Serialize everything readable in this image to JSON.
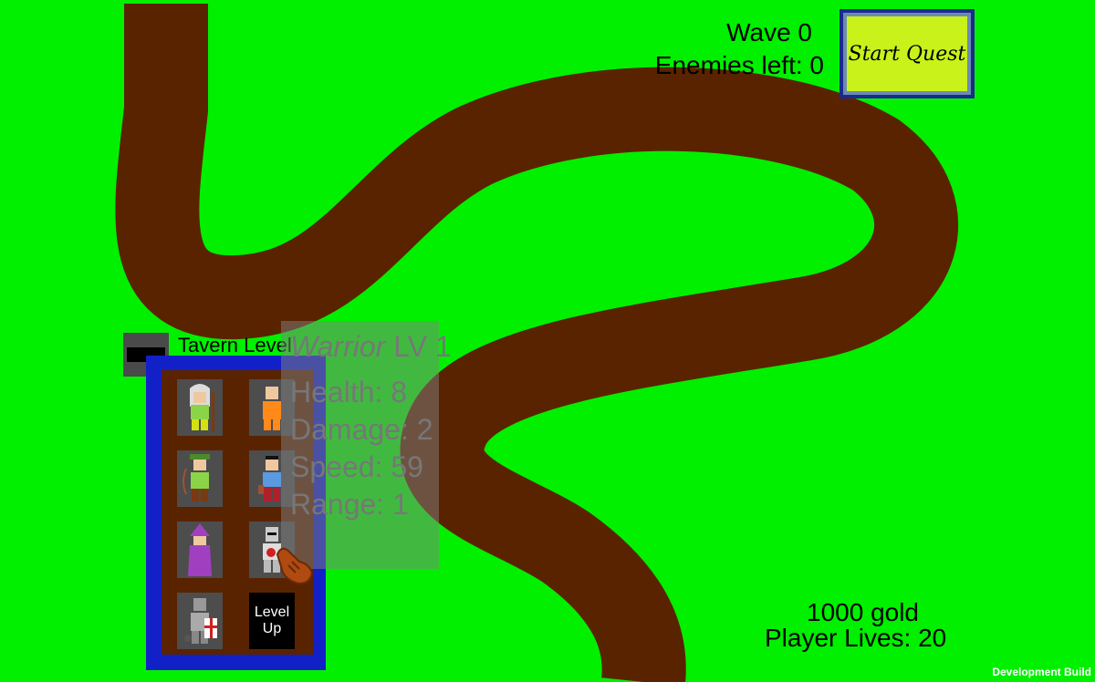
{
  "hud": {
    "wave_text": "Wave 0",
    "enemies_text": "Enemies left: 0",
    "start_button_label": "Start Quest",
    "gold_text": "1000 gold",
    "lives_text": "Player Lives: 20"
  },
  "tavern": {
    "label": "Tavern Level",
    "heroes": [
      {
        "name": "elder-mage-icon"
      },
      {
        "name": "monk-icon"
      },
      {
        "name": "archer-icon"
      },
      {
        "name": "rogue-icon"
      },
      {
        "name": "wizard-icon"
      },
      {
        "name": "knight-icon"
      },
      {
        "name": "paladin-icon"
      }
    ],
    "level_up_line1": "Level",
    "level_up_line2": "Up"
  },
  "info": {
    "class_name": "Warrior",
    "level_text": "LV 1",
    "health": "Health: 8",
    "damage": "Damage: 2",
    "speed": "Speed: 59",
    "range": "Range: 1"
  },
  "footer": {
    "build_label": "Development Build"
  },
  "colors": {
    "grass": "#00f000",
    "path": "#5a2300",
    "tavern_frame": "#1220c8",
    "start_button": "#c8f21a"
  }
}
